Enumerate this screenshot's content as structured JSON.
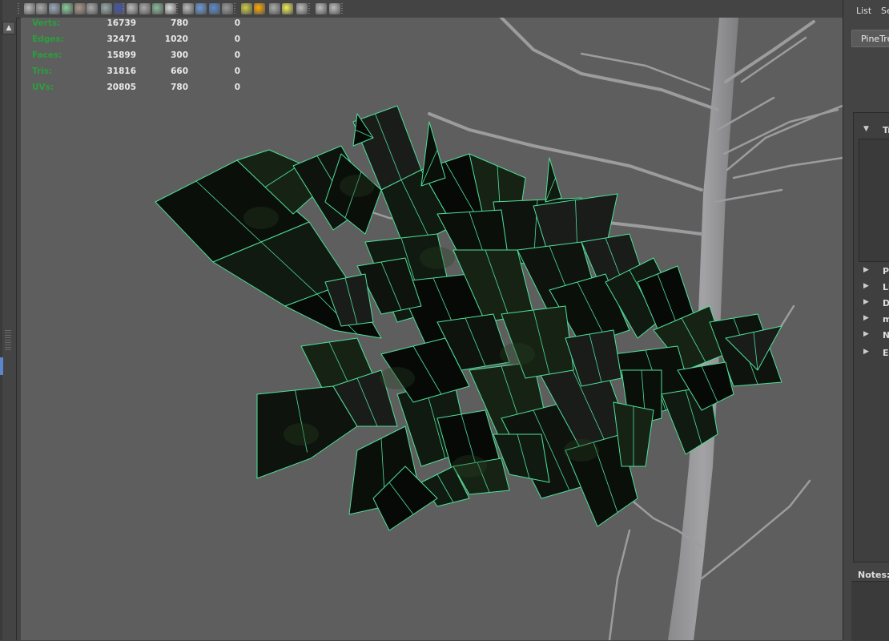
{
  "toolbar": {
    "icons": [
      "camera-icon",
      "camera-attributes-icon",
      "bookmark-icon",
      "image-plane-icon",
      "snapshot-icon",
      "grid-icon",
      "film-gate-icon",
      "resolution-gate-icon",
      "gate-mask-icon",
      "field-chart-icon",
      "safe-action-icon",
      "safe-title-icon",
      "wireframe-cube-icon",
      "smooth-shade-icon",
      "shaded-wireframe-icon",
      "textured-icon",
      "lights-icon",
      "shadows-icon",
      "xray-icon",
      "isolate-select-icon",
      "isolate-icon",
      "frame-icon",
      "node-editor-icon"
    ]
  },
  "hud": {
    "rows": [
      {
        "label": "Verts:",
        "v1": "16739",
        "v2": "780",
        "v3": "0"
      },
      {
        "label": "Edges:",
        "v1": "32471",
        "v2": "1020",
        "v3": "0"
      },
      {
        "label": "Faces:",
        "v1": "15899",
        "v2": "300",
        "v3": "0"
      },
      {
        "label": "Tris:",
        "v1": "31816",
        "v2": "660",
        "v3": "0"
      },
      {
        "label": "UVs:",
        "v1": "20805",
        "v2": "780",
        "v3": "0"
      }
    ]
  },
  "right_panel": {
    "menu_list": "List",
    "menu_se": "Se",
    "tab_label": "PineTre",
    "sections": [
      {
        "label": "Tr",
        "expanded": true
      },
      {
        "label": "Pi",
        "expanded": false
      },
      {
        "label": "Li",
        "expanded": false
      },
      {
        "label": "D",
        "expanded": false
      },
      {
        "label": "m",
        "expanded": false
      },
      {
        "label": "N",
        "expanded": false
      },
      {
        "label": "Ex",
        "expanded": false
      }
    ],
    "notes_label": "Notes:"
  },
  "colors": {
    "viewport_bg": "#5e5e5e",
    "hud_label": "#2b9f3c",
    "selection_wire": "#4fe09a",
    "trunk": "#9a9a9c"
  }
}
